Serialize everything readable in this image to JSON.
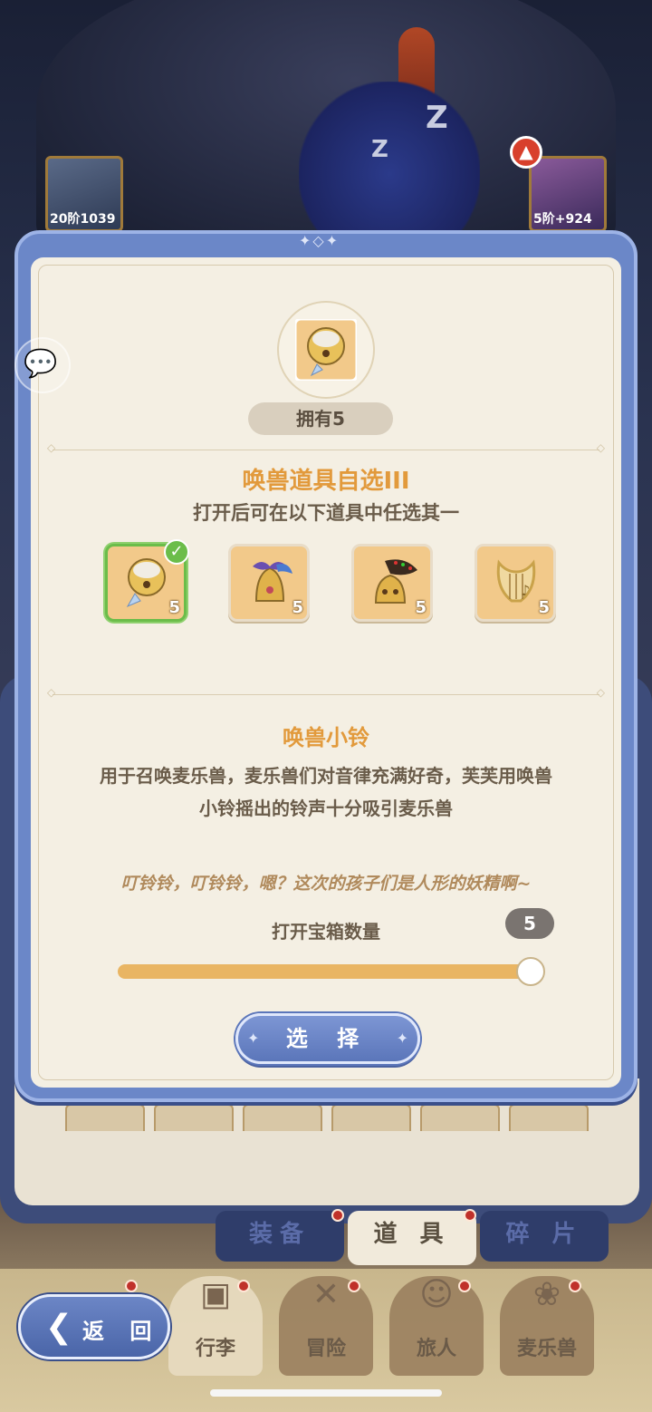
{
  "hud": {
    "left_card_tag": "20阶1039",
    "right_card_tag": "5阶+924"
  },
  "dialog": {
    "owned": "拥有5",
    "box_title": "唤兽道具自选III",
    "box_subtitle": "打开后可在以下道具中任选其一",
    "items": [
      {
        "name": "bell-with-tassel",
        "count": "5",
        "selected": true
      },
      {
        "name": "bell-with-ribbon",
        "count": "5",
        "selected": false
      },
      {
        "name": "bell-with-hat",
        "count": "5",
        "selected": false
      },
      {
        "name": "lyre",
        "count": "5",
        "selected": false
      }
    ],
    "item_name": "唤兽小铃",
    "item_desc_line1": "用于召唤麦乐兽，麦乐兽们对音律充满好奇，芙芙用唤兽",
    "item_desc_line2": "小铃摇出的铃声十分吸引麦乐兽",
    "quote": "叮铃铃，叮铃铃，嗯？这次的孩子们是人形的妖精啊~",
    "quantity_label": "打开宝箱数量",
    "quantity_value": "5",
    "quantity_fraction": 1.0,
    "select_button": "选 择"
  },
  "tabs": [
    "装备",
    "道 具",
    "碎 片"
  ],
  "active_tab": 1,
  "nav": {
    "back_label": "返 回",
    "items": [
      "行李",
      "冒险",
      "旅人",
      "麦乐兽"
    ]
  },
  "colors": {
    "accent_orange": "#e29a3c",
    "dialog_blue": "#6b87c8",
    "parchment": "#f4efe3",
    "selected_green": "#6bbd4a"
  }
}
